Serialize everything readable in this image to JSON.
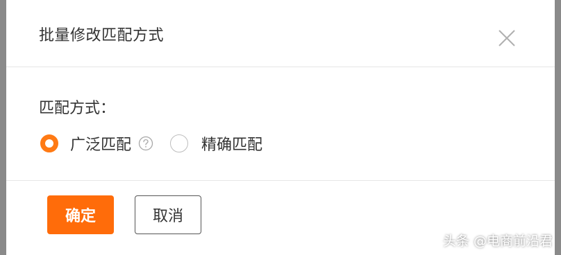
{
  "dialog": {
    "title": "批量修改匹配方式",
    "close_icon": "close-icon"
  },
  "form": {
    "label": "匹配方式：",
    "options": [
      {
        "label": "广泛匹配",
        "checked": true,
        "has_help": true
      },
      {
        "label": "精确匹配",
        "checked": false,
        "has_help": false
      }
    ],
    "help_icon": "question-circle-icon"
  },
  "footer": {
    "confirm_label": "确定",
    "cancel_label": "取消"
  },
  "watermark": {
    "text": "头条 @电商前沿君"
  },
  "colors": {
    "accent": "#ff6c0a",
    "radio_checked": "#ff7a14",
    "text": "#333333",
    "divider": "#e6e6e6"
  }
}
